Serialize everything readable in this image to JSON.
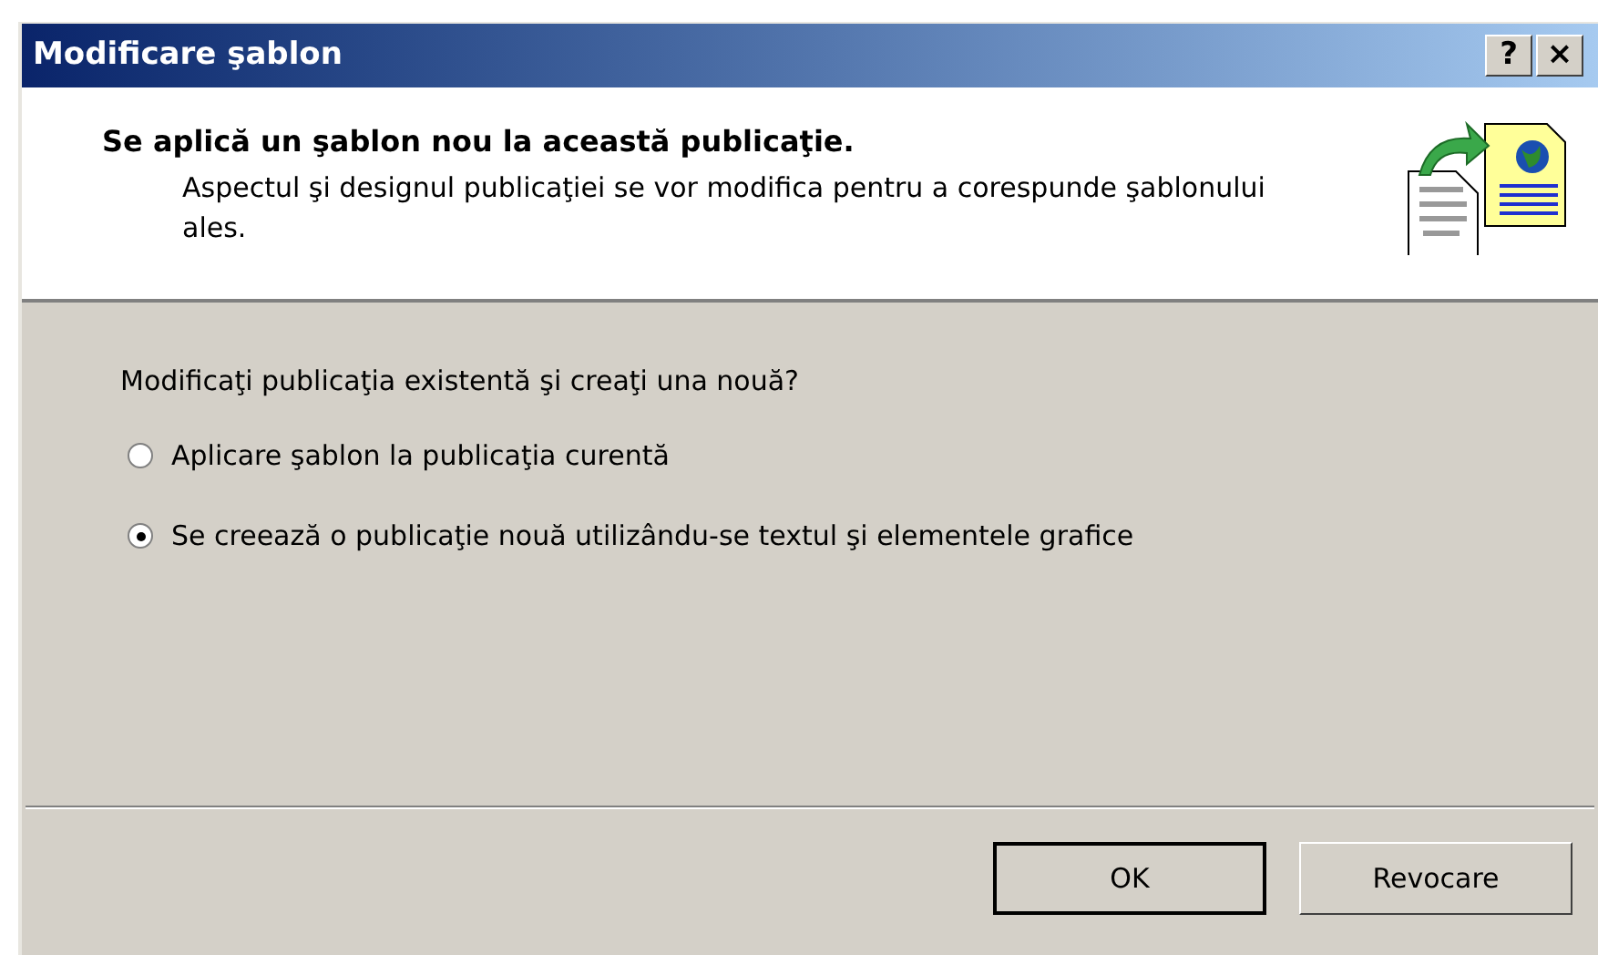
{
  "window": {
    "title": "Modificare şablon",
    "controls": [
      "?",
      "×"
    ]
  },
  "header": {
    "title": "Se aplică un şablon nou la această publicaţie.",
    "description": "Aspectul şi designul publicaţiei se vor modifica pentru a corespunde şablonului ales."
  },
  "question": "Modificaţi publicaţia existentă şi creaţi una nouă?",
  "options": [
    {
      "label": "Aplicare şablon la publicaţia curentă",
      "selected": false
    },
    {
      "label": "Se creează o publicaţie nouă utilizându-se textul şi elementele grafice",
      "selected": true
    }
  ],
  "buttons": [
    {
      "label": "OK",
      "default": true
    },
    {
      "label": "Revocare",
      "default": false
    }
  ]
}
